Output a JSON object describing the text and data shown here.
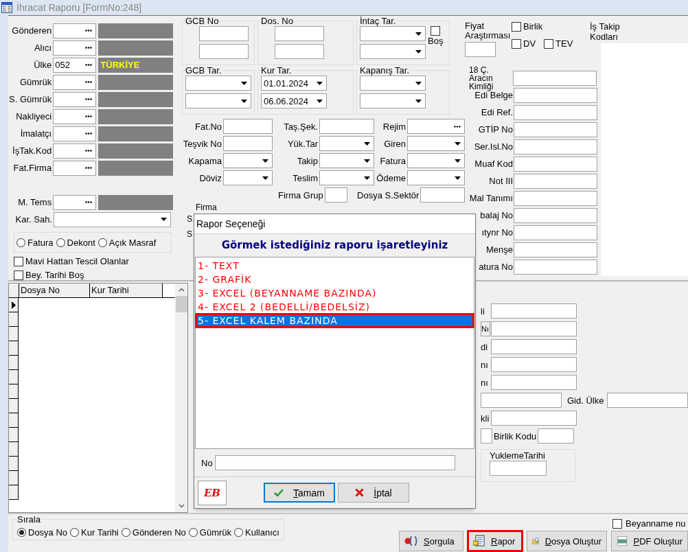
{
  "window": {
    "title": "İhracat Raporu [FormNo:248]"
  },
  "left_fields": [
    {
      "label": "Gönderen",
      "kind": "lookup"
    },
    {
      "label": "Alıcı",
      "kind": "lookup"
    },
    {
      "label": "Ülke",
      "kind": "lookup",
      "code": "052",
      "description": "TÜRKİYE"
    },
    {
      "label": "Gümrük",
      "kind": "lookup"
    },
    {
      "label": "S. Gümrük",
      "kind": "lookup"
    },
    {
      "label": "Nakliyeci",
      "kind": "lookup"
    },
    {
      "label": "İmalatçı",
      "kind": "lookup"
    },
    {
      "label": "İşTak.Kod",
      "kind": "lookup"
    },
    {
      "label": "Fat.Firma",
      "kind": "lookup"
    },
    {
      "kind": "gap"
    },
    {
      "label": "M. Tems",
      "kind": "lookup"
    },
    {
      "label": "Kar. Sah.",
      "kind": "combo"
    }
  ],
  "document_type_options": [
    {
      "label": "Fatura",
      "selected": false
    },
    {
      "label": "Dekont",
      "selected": false
    },
    {
      "label": "Açık Masraf",
      "selected": false
    }
  ],
  "left_checkboxes": [
    {
      "label": "Mavi Hattan Tescil Olanlar",
      "checked": false
    },
    {
      "label": "Bey. Tarihi Boş",
      "checked": false
    }
  ],
  "range_groups": [
    {
      "title": "GCB No",
      "kind": "text"
    },
    {
      "title": "Dos. No",
      "kind": "text"
    },
    {
      "title": "İntaç Tar.",
      "kind": "date",
      "checkbox": {
        "label": "Boş",
        "checked": false
      }
    },
    {
      "title": "GCB Tar.",
      "kind": "date"
    },
    {
      "title": "Kur Tar.",
      "kind": "date",
      "values": [
        "01.01.2024",
        "06.06.2024"
      ]
    },
    {
      "title": "Kapanış Tar.",
      "kind": "date"
    }
  ],
  "filter_fields": [
    [
      {
        "label": "Fat.No",
        "kind": "text"
      },
      {
        "label": "Taş.Şek.",
        "kind": "text"
      },
      {
        "label": "Rejim",
        "kind": "lookup"
      }
    ],
    [
      {
        "label": "Teşvik No",
        "kind": "text"
      },
      {
        "label": "Yük.Tar",
        "kind": "combo"
      },
      {
        "label": "Giren",
        "kind": "combo"
      }
    ],
    [
      {
        "label": "Kapama",
        "kind": "combo"
      },
      {
        "label": "Takip",
        "kind": "combo"
      },
      {
        "label": "Fatura",
        "kind": "combo"
      }
    ],
    [
      {
        "label": "Döviz",
        "kind": "combo"
      },
      {
        "label": "Teslim",
        "kind": "combo"
      },
      {
        "label": "Ödeme",
        "kind": "combo"
      }
    ]
  ],
  "extra_fields": [
    {
      "label": "Firma Grup"
    },
    {
      "label": "Dosya S.Sektör"
    }
  ],
  "partial_labels": [
    "Firma",
    "S",
    "S"
  ],
  "price_research": {
    "label": "Fiyat Araştırması"
  },
  "flags": [
    {
      "label": "Birlik",
      "checked": false
    },
    {
      "label": "DV",
      "checked": false
    },
    {
      "label": "TEV",
      "checked": false
    }
  ],
  "job_codes": {
    "label": "İş Takip Kodları"
  },
  "right_fields": [
    "18 Ç. Aracın Kimliği",
    "Edi Belge",
    "Edi Ref.",
    "GTİP No",
    "Ser.Isl.No",
    "Muaf Kod",
    "Not III",
    "Mal Tanımı",
    "balaj No",
    "ıtynr No",
    "Menşe",
    "atura No"
  ],
  "grid": {
    "columns": [
      "Dosya No",
      "Kur Tarihi"
    ]
  },
  "lower_fields": [
    {
      "label": "li",
      "kind": "text"
    },
    {
      "label": "Nı",
      "kind": "boxed"
    },
    {
      "label": "di",
      "kind": "text"
    },
    {
      "label": "nı",
      "kind": "text"
    },
    {
      "label": "nı",
      "kind": "text"
    },
    {
      "label": "Gid. Ülke",
      "kind": "wide"
    },
    {
      "label": "kli",
      "kind": "text"
    },
    {
      "label": "Birlik Kodu",
      "kind": "pair"
    }
  ],
  "loading_date": {
    "title": "YuklemeTarihi"
  },
  "sort": {
    "title": "Sırala",
    "options": [
      {
        "label": "Dosya No",
        "selected": true
      },
      {
        "label": "Kur Tarihi",
        "selected": false
      },
      {
        "label": "Gönderen No",
        "selected": false
      },
      {
        "label": "Gümrük",
        "selected": false
      },
      {
        "label": "Kullanıcı",
        "selected": false
      }
    ]
  },
  "declaration_checkbox": {
    "label": "Beyanname nu",
    "checked": false
  },
  "actions": [
    {
      "label": "Sorgula",
      "kind": "query",
      "highlighted": false
    },
    {
      "label": "Rapor",
      "kind": "report",
      "highlighted": true
    },
    {
      "label": "Dosya Oluştur",
      "kind": "folder",
      "highlighted": false
    },
    {
      "label": "PDF Oluştur",
      "kind": "pdf",
      "highlighted": false
    }
  ],
  "dialog": {
    "title": "Rapor Seçeneği",
    "prompt": "Görmek istediğiniz raporu işaretleyiniz",
    "options": [
      {
        "label": "1- TEXT",
        "selected": false,
        "highlighted": false
      },
      {
        "label": "2- GRAFİK",
        "selected": false,
        "highlighted": false
      },
      {
        "label": "3- EXCEL (BEYANNAME BAZINDA)",
        "selected": false,
        "highlighted": false
      },
      {
        "label": "4- EXCEL 2 (BEDELLİ/BEDELSİZ)",
        "selected": false,
        "highlighted": false
      },
      {
        "label": "5- EXCEL KALEM BAZINDA",
        "selected": true,
        "highlighted": true
      }
    ],
    "number_label": "No",
    "logo_text": "EB",
    "buttons": [
      {
        "label": "Tamam",
        "kind": "ok",
        "focused": true
      },
      {
        "label": "İptal",
        "kind": "cancel",
        "focused": false
      }
    ]
  }
}
